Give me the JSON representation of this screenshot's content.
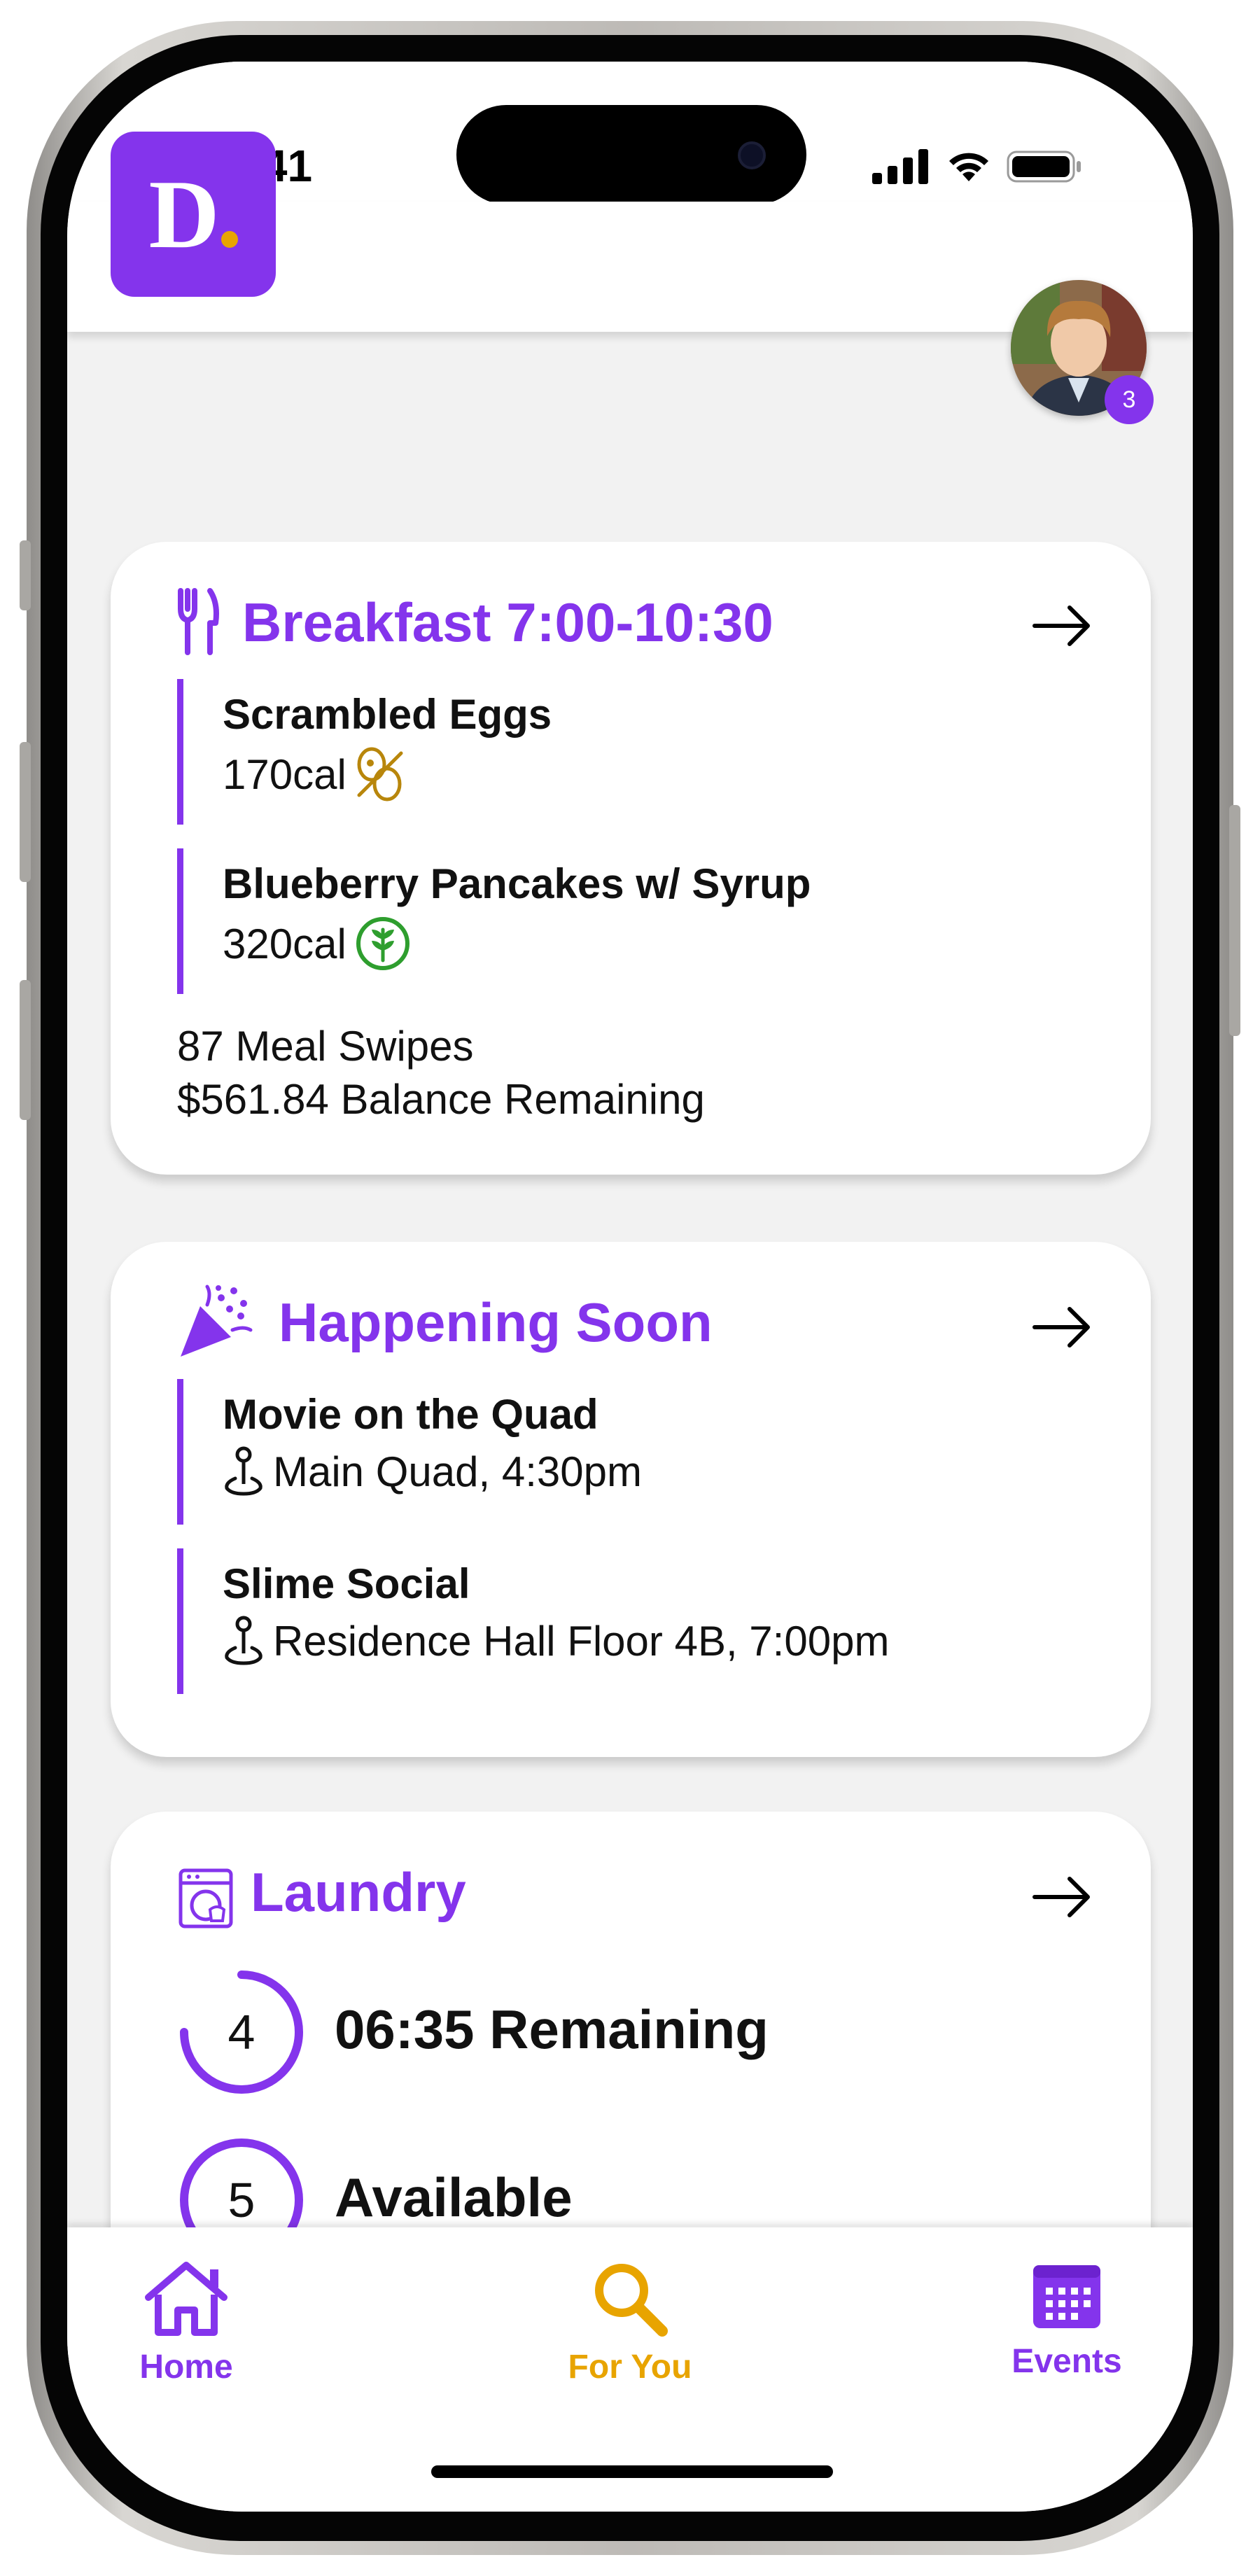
{
  "status_bar": {
    "time": "9:41"
  },
  "header": {
    "logo_letter": "D",
    "notification_count": "3",
    "accent_color": "#8434ec",
    "logo_dot_color": "#e8a400"
  },
  "breakfast_card": {
    "title": "Breakfast 7:00-10:30",
    "icon": "fork-knife-icon",
    "items": [
      {
        "name": "Scrambled Eggs",
        "calories": "170cal",
        "icon": "egg-allergen-icon"
      },
      {
        "name": "Blueberry Pancakes w/ Syrup",
        "calories": "320cal",
        "icon": "vegetarian-icon"
      }
    ],
    "meal_swipes": "87 Meal Swipes",
    "balance": "$561.84 Balance Remaining"
  },
  "events_card": {
    "title": "Happening Soon",
    "icon": "party-popper-icon",
    "events": [
      {
        "name": "Movie on the Quad",
        "location": "Main Quad, 4:30pm",
        "icon": "location-pin-icon"
      },
      {
        "name": "Slime Social",
        "location": "Residence Hall Floor 4B, 7:00pm",
        "icon": "location-pin-icon"
      }
    ]
  },
  "laundry_card": {
    "title": "Laundry",
    "icon": "washing-machine-icon",
    "machines": [
      {
        "number": "4",
        "status": "06:35 Remaining",
        "progress": 0.75
      },
      {
        "number": "5",
        "status": "Available",
        "progress": 1.0
      }
    ]
  },
  "tab_bar": {
    "tabs": [
      {
        "label": "Home",
        "icon": "home-icon",
        "color": "#8434ec"
      },
      {
        "label": "For You",
        "icon": "search-icon",
        "color": "#e8a400"
      },
      {
        "label": "Events",
        "icon": "calendar-icon",
        "color": "#8434ec"
      }
    ]
  }
}
